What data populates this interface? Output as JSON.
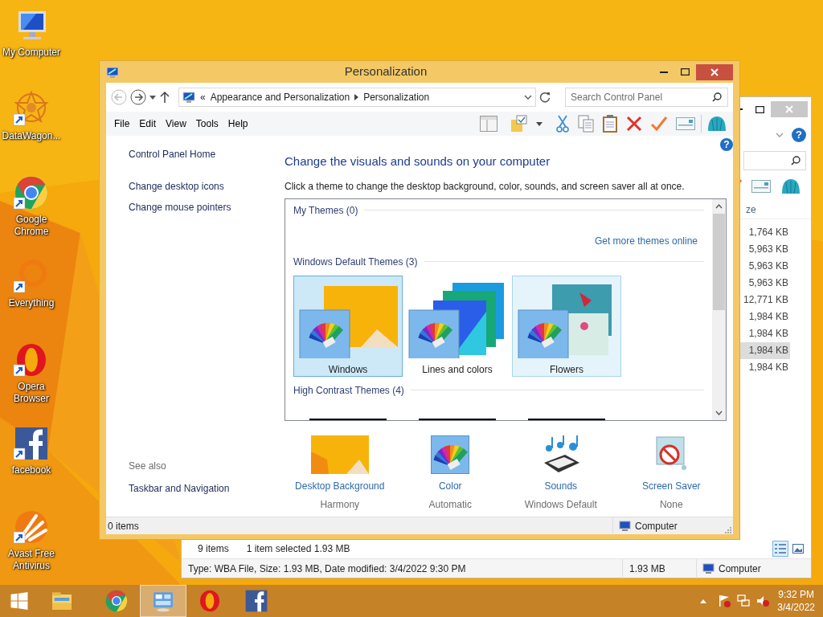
{
  "desktop_icons": [
    {
      "label": "My Computer",
      "kind": "computer",
      "shortcut": false
    },
    {
      "label": "DataWagon...",
      "kind": "datawagon",
      "shortcut": true
    },
    {
      "label": "Google Chrome",
      "kind": "chrome",
      "shortcut": true
    },
    {
      "label": "Everything",
      "kind": "everything",
      "shortcut": true
    },
    {
      "label": "Opera Browser",
      "kind": "opera",
      "shortcut": true
    },
    {
      "label": "facebook",
      "kind": "facebook",
      "shortcut": true
    },
    {
      "label": "Avast Free Antivirus",
      "kind": "avast",
      "shortcut": true
    }
  ],
  "background_window": {
    "help_glyph": "?",
    "size_column_header": "ze",
    "sizes": [
      {
        "text": "1,764 KB",
        "selected": false
      },
      {
        "text": "5,963 KB",
        "selected": false
      },
      {
        "text": "5,963 KB",
        "selected": false
      },
      {
        "text": "5,963 KB",
        "selected": false
      },
      {
        "text": "12,771 KB",
        "selected": false
      },
      {
        "text": "1,984 KB",
        "selected": false
      },
      {
        "text": "1,984 KB",
        "selected": false
      },
      {
        "text": "1,984 KB",
        "selected": true
      },
      {
        "text": "1,984 KB",
        "selected": false
      }
    ],
    "status": {
      "items": "9 items",
      "selection": "1 item selected  1.93 MB"
    },
    "view_buttons": [
      {
        "kind": "details",
        "selected": true
      },
      {
        "kind": "preview",
        "selected": false
      }
    ],
    "details": {
      "info": "Type: WBA File, Size: 1.93 MB, Date modified: 3/4/2022 9:30 PM",
      "size": "1.93 MB",
      "location": "Computer"
    }
  },
  "window": {
    "title": "Personalization",
    "address": {
      "overflow": "«",
      "crumbs": [
        "Appearance and Personalization",
        "Personalization"
      ]
    },
    "search": {
      "placeholder": "Search Control Panel"
    },
    "menu": [
      "File",
      "Edit",
      "View",
      "Tools",
      "Help"
    ],
    "help_glyph": "?",
    "nav": {
      "links": [
        "Control Panel Home",
        "Change desktop icons",
        "Change mouse pointers"
      ],
      "see_also_label": "See also",
      "see_also": [
        "Taskbar and Navigation"
      ]
    },
    "heading": "Change the visuals and sounds on your computer",
    "description": "Click a theme to change the desktop background, color, sounds, and screen saver all at once.",
    "theme_groups": [
      {
        "label": "My Themes (0)",
        "link": "Get more themes online"
      },
      {
        "label": "Windows Default Themes (3)",
        "items": [
          {
            "name": "Windows",
            "kind": "windows",
            "selected": true,
            "hovered": false
          },
          {
            "name": "Lines and colors",
            "kind": "lines",
            "selected": false,
            "hovered": false
          },
          {
            "name": "Flowers",
            "kind": "flowers",
            "selected": false,
            "hovered": true
          }
        ]
      },
      {
        "label": "High Contrast Themes (4)",
        "items": [
          {
            "kind": "high_contrast"
          },
          {
            "kind": "high_contrast"
          },
          {
            "kind": "high_contrast"
          }
        ]
      }
    ],
    "settings": [
      {
        "label": "Desktop Background",
        "value": "Harmony",
        "kind": "background"
      },
      {
        "label": "Color",
        "value": "Automatic",
        "kind": "color"
      },
      {
        "label": "Sounds",
        "value": "Windows Default",
        "kind": "sounds"
      },
      {
        "label": "Screen Saver",
        "value": "None",
        "kind": "screensaver"
      }
    ],
    "status_bar": {
      "items": "0 items",
      "location": "Computer"
    }
  },
  "taskbar": {
    "apps": [
      {
        "kind": "start",
        "active": false
      },
      {
        "kind": "explorer",
        "active": false
      },
      {
        "kind": "chrome",
        "active": false
      },
      {
        "kind": "control_panel",
        "active": true
      },
      {
        "kind": "opera",
        "active": false
      },
      {
        "kind": "facebook",
        "active": false
      }
    ],
    "clock": {
      "time": "9:32 PM",
      "date": "3/4/2022"
    }
  }
}
